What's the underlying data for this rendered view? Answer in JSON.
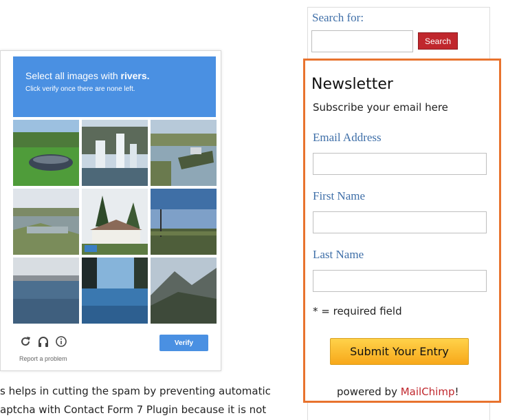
{
  "captcha": {
    "title_prefix": "Select all images with ",
    "title_keyword": "rivers.",
    "subtitle": "Click verify once there are none left.",
    "tiles": [
      {
        "name": "tile-grass-boat"
      },
      {
        "name": "tile-fountain"
      },
      {
        "name": "tile-canal-boats"
      },
      {
        "name": "tile-riverbank"
      },
      {
        "name": "tile-house-trees"
      },
      {
        "name": "tile-field-pole"
      },
      {
        "name": "tile-sea-horizon"
      },
      {
        "name": "tile-flooded-street"
      },
      {
        "name": "tile-mountain"
      }
    ],
    "reload_icon": "reload-icon",
    "audio_icon": "headphones-icon",
    "info_icon": "info-icon",
    "verify_label": "Verify",
    "report_label": "Report a problem",
    "accent_color": "#4a90e2"
  },
  "body_text": {
    "line1": "s helps in cutting the spam by preventing automatic",
    "line2": "aptcha with Contact Form 7 Plugin because it is not"
  },
  "sidebar": {
    "search_label": "Search for:",
    "search_value": "",
    "search_button": "Search",
    "search_button_color": "#c0272d"
  },
  "newsletter": {
    "title": "Newsletter",
    "subtitle": "Subscribe your email here",
    "fields": [
      {
        "label": "Email Address",
        "value": ""
      },
      {
        "label": "First Name",
        "value": ""
      },
      {
        "label": "Last Name",
        "value": ""
      }
    ],
    "required_note": "* = required field",
    "submit_label": "Submit Your Entry",
    "powered_prefix": "powered by ",
    "powered_link": "MailChimp",
    "powered_suffix": "!",
    "highlight_color": "#e8732e"
  }
}
